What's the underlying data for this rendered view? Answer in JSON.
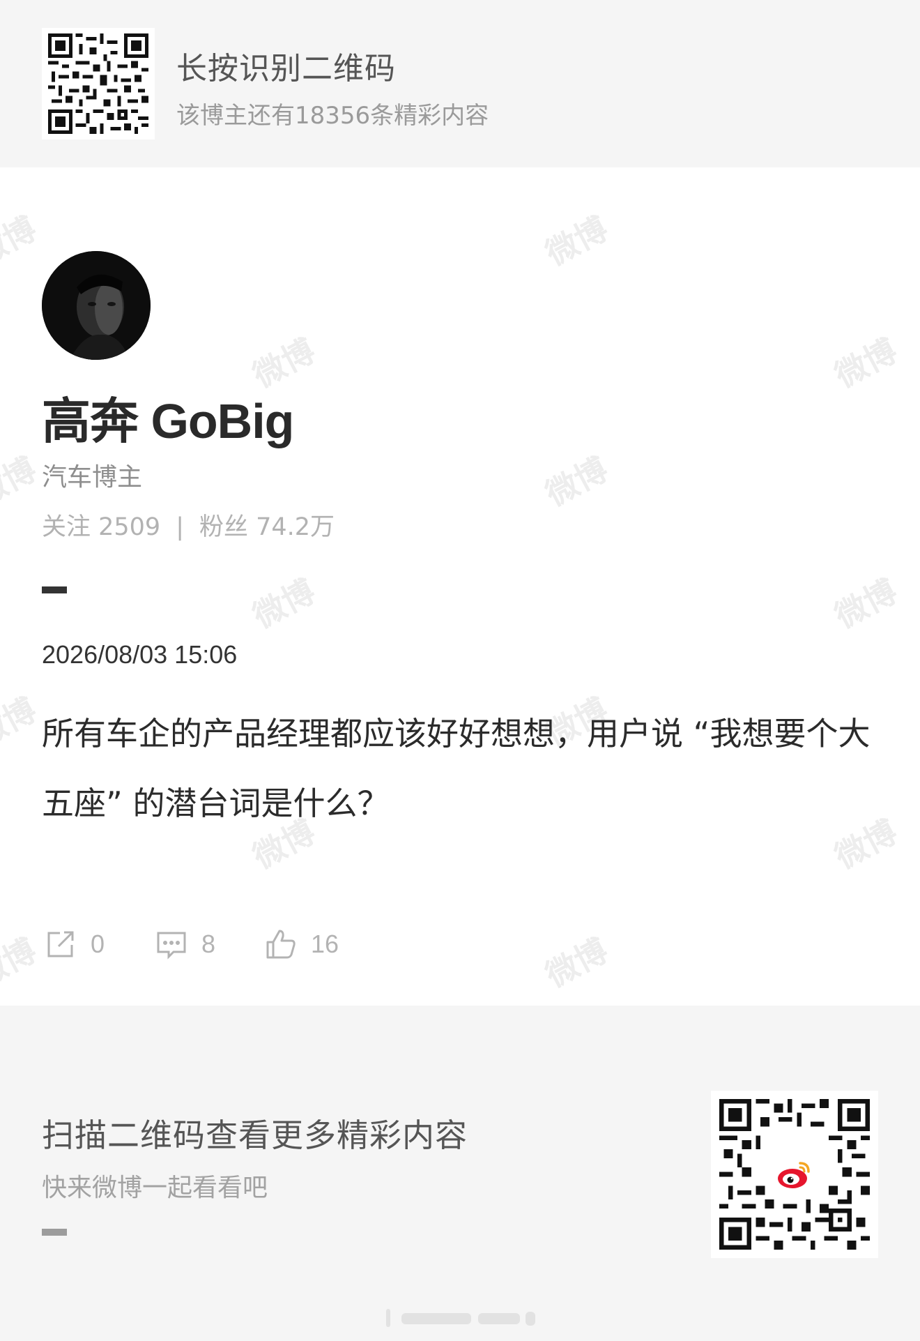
{
  "top_banner": {
    "title": "长按识别二维码",
    "subtitle": "该博主还有18356条精彩内容"
  },
  "author": {
    "name": "高奔 GoBig",
    "tag": "汽车博主",
    "following_label": "关注 2509",
    "separator": "|",
    "followers_label": "粉丝 74.2万"
  },
  "post": {
    "time": "2026/08/03 15:06",
    "text": "所有车企的产品经理都应该好好想想，用户说 “我想要个大五座” 的潜台词是什么？"
  },
  "actions": {
    "repost_count": "0",
    "comment_count": "8",
    "like_count": "16"
  },
  "bottom": {
    "title": "扫描二维码查看更多精彩内容",
    "subtitle": "快来微博一起看看吧"
  },
  "watermark_text": "微博",
  "colors": {
    "banner_bg": "#f5f5f5",
    "weibo_red": "#e6162d",
    "weibo_orange": "#f4a623"
  }
}
